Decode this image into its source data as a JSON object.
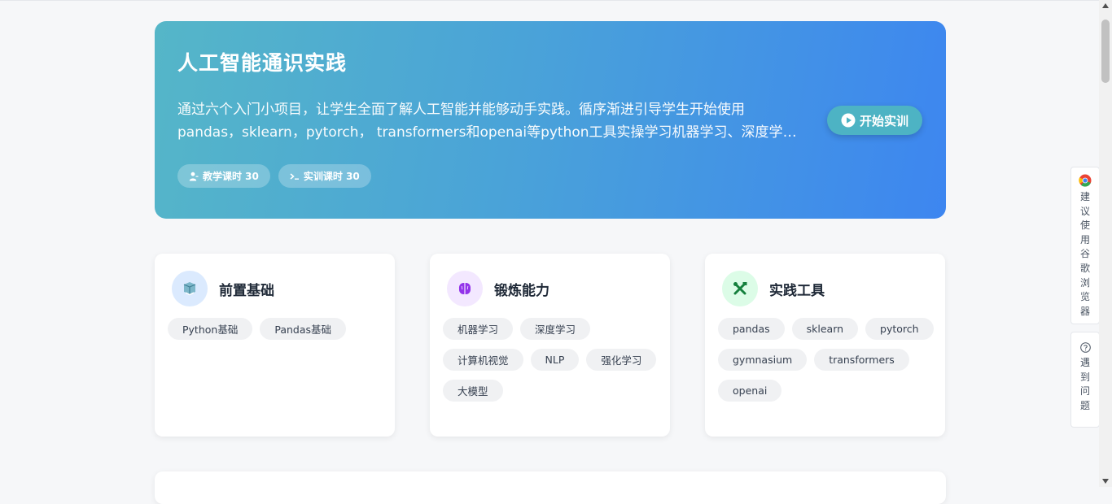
{
  "hero": {
    "title": "人工智能通识实践",
    "desc_line1": "通过六个入门小项目，让学生全面了解人工智能并能够动手实践。循序渐进引导学生开始使用",
    "desc_line2": "pandas，sklearn，pytorch， transformers和openai等python工具实操学习机器学习、深度学习、计算机视觉、NLP、强化学习和大模型",
    "chips": [
      {
        "icon": "teacher-icon",
        "label": "教学课时 30"
      },
      {
        "icon": "terminal-icon",
        "label": "实训课时 30"
      }
    ],
    "start_button": "开始实训"
  },
  "cards": [
    {
      "icon": "book-icon",
      "title": "前置基础",
      "tags": [
        "Python基础",
        "Pandas基础"
      ]
    },
    {
      "icon": "brain-icon",
      "title": "锻炼能力",
      "tags": [
        "机器学习",
        "深度学习",
        "计算机视觉",
        "NLP",
        "强化学习",
        "大模型"
      ]
    },
    {
      "icon": "tools-icon",
      "title": "实践工具",
      "tags": [
        "pandas",
        "sklearn",
        "pytorch",
        "gymnasium",
        "transformers",
        "openai"
      ]
    }
  ],
  "side": {
    "browser_tip": [
      "建",
      "议",
      "使",
      "用",
      "谷",
      "歌",
      "浏",
      "览",
      "器"
    ],
    "help": [
      "遇",
      "到",
      "问",
      "题"
    ]
  },
  "colors": {
    "hero_gradient_start": "#55b6c8",
    "hero_gradient_end": "#3d86f0",
    "start_button": "#4db3c4",
    "book_icon_bg": "#dbeafe",
    "brain_icon_bg": "#f3e8ff",
    "tools_icon_bg": "#dcfce7"
  }
}
